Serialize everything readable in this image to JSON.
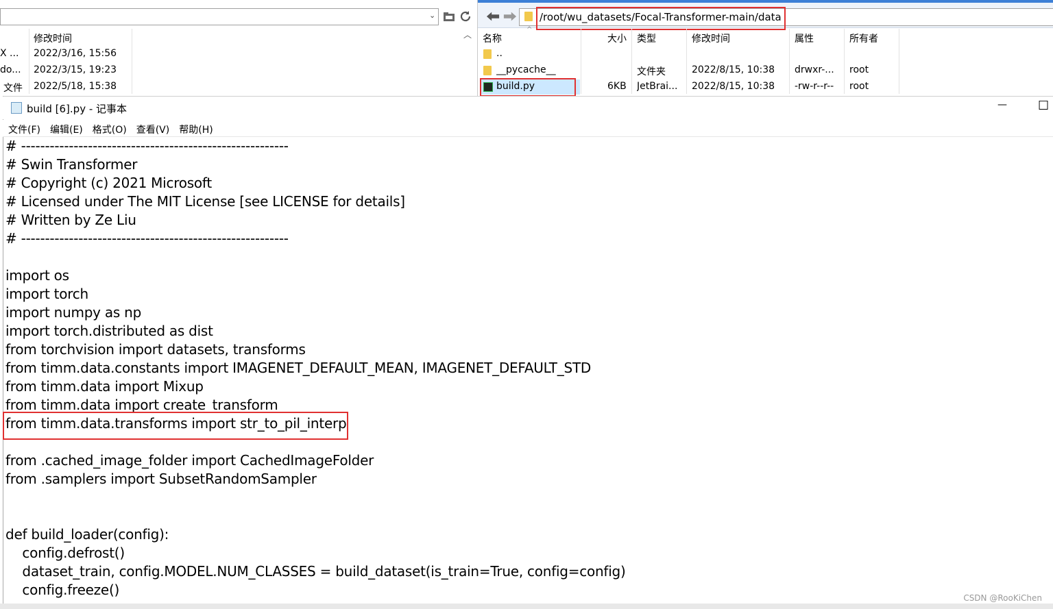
{
  "left_pane": {
    "columns": [
      "修改时间"
    ],
    "rows": [
      {
        "name": "X ...",
        "modified": "2022/3/16, 15:56"
      },
      {
        "name": "do...",
        "modified": "2022/3/15, 19:23"
      },
      {
        "name": "文件",
        "modified": "2022/5/18, 15:38"
      }
    ]
  },
  "right_pane": {
    "path": "/root/wu_datasets/Focal-Transformer-main/data",
    "columns": {
      "name": "名称",
      "size": "大小",
      "type": "类型",
      "modified": "修改时间",
      "attrs": "属性",
      "owner": "所有者"
    },
    "rows": [
      {
        "name": "..",
        "size": "",
        "type": "",
        "modified": "",
        "attrs": "",
        "owner": ""
      },
      {
        "name": "__pycache__",
        "size": "",
        "type": "文件夹",
        "modified": "2022/8/15, 10:38",
        "attrs": "drwxr-...",
        "owner": "root"
      },
      {
        "name": "build.py",
        "size": "6KB",
        "type": "JetBrai...",
        "modified": "2022/8/15, 10:38",
        "attrs": "-rw-r--r--",
        "owner": "root"
      }
    ]
  },
  "notepad": {
    "title": "build [6].py - 记事本",
    "menu": [
      "文件(F)",
      "编辑(E)",
      "格式(O)",
      "查看(V)",
      "帮助(H)"
    ],
    "lines": [
      "# --------------------------------------------------------",
      "# Swin Transformer",
      "# Copyright (c) 2021 Microsoft",
      "# Licensed under The MIT License [see LICENSE for details]",
      "# Written by Ze Liu",
      "# --------------------------------------------------------",
      "",
      "import os",
      "import torch",
      "import numpy as np",
      "import torch.distributed as dist",
      "from torchvision import datasets, transforms",
      "from timm.data.constants import IMAGENET_DEFAULT_MEAN, IMAGENET_DEFAULT_STD",
      "from timm.data import Mixup",
      "from timm.data import create_transform",
      "from timm.data.transforms import str_to_pil_interp",
      "",
      "from .cached_image_folder import CachedImageFolder",
      "from .samplers import SubsetRandomSampler",
      "",
      "",
      "def build_loader(config):",
      "    config.defrost()",
      "    dataset_train, config.MODEL.NUM_CLASSES = build_dataset(is_train=True, config=config)",
      "    config.freeze()"
    ],
    "minimize_glyph": "—",
    "maximize_glyph": "☐"
  },
  "watermark": "CSDN @RooKiChen",
  "colors": {
    "highlight_box": "#e03030",
    "selected_row": "#cce8ff",
    "folder": "#f2c94c"
  }
}
